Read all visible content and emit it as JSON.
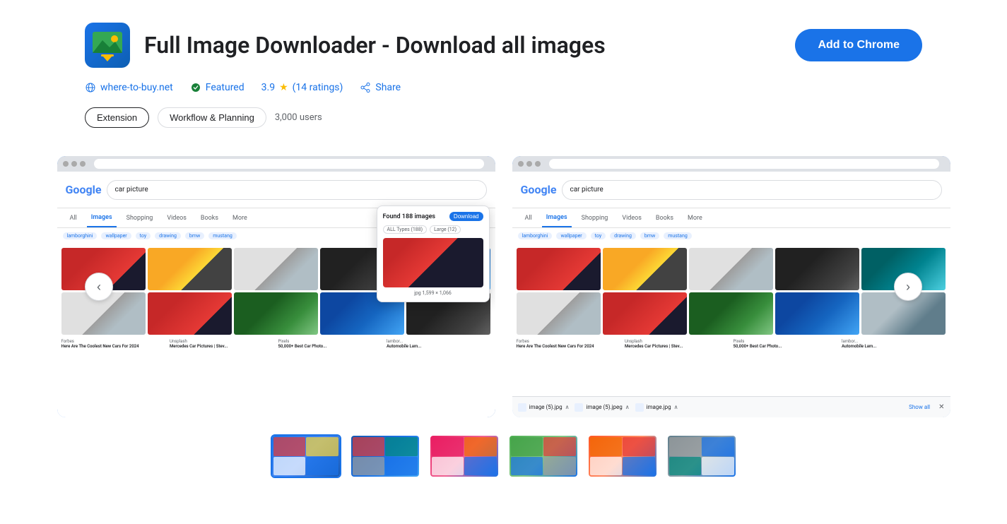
{
  "header": {
    "title": "Full Image Downloader - Download all images",
    "add_to_chrome_label": "Add to Chrome"
  },
  "meta": {
    "website": "where-to-buy.net",
    "featured_label": "Featured",
    "rating_value": "3.9",
    "rating_count": "(14 ratings)",
    "share_label": "Share"
  },
  "tags": [
    {
      "label": "Extension",
      "active": true
    },
    {
      "label": "Workflow & Planning",
      "active": false
    }
  ],
  "users_count": "3,000 users",
  "nav": {
    "prev_label": "‹",
    "next_label": "›"
  },
  "screenshot1": {
    "popup": {
      "title": "Found 188 images",
      "download_label": "Download",
      "filter1": "ALL Types (188)",
      "filter2": "Large (12)",
      "image_meta": "jpg  1,599 × 1,066"
    }
  },
  "screenshot2": {
    "download_bar": {
      "item1": "image (5).jpg",
      "item2": "image (5).jpeg",
      "item3": "image.jpg",
      "show_all": "Show all"
    }
  },
  "thumbnails": [
    {
      "id": 1,
      "active": true
    },
    {
      "id": 2,
      "active": false
    },
    {
      "id": 3,
      "active": false
    },
    {
      "id": 4,
      "active": false
    },
    {
      "id": 5,
      "active": false
    },
    {
      "id": 6,
      "active": false
    }
  ]
}
